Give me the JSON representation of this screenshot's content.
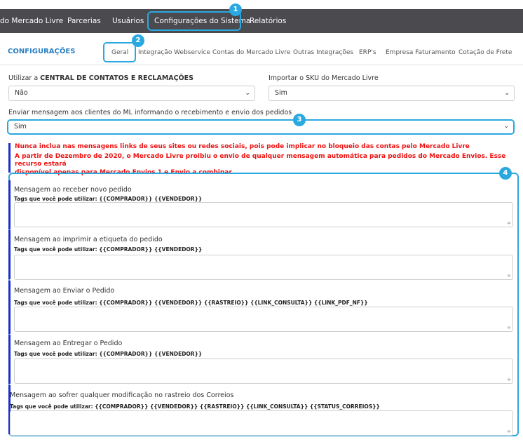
{
  "topnav": {
    "items": [
      "do Mercado Livre",
      "Parcerias",
      "Usuários",
      "Configurações do Sistema",
      "Relatórios"
    ]
  },
  "badges": [
    "1",
    "2",
    "3",
    "4"
  ],
  "config": {
    "title": "CONFIGURAÇÕES",
    "tabs": [
      "Geral",
      "Integração Webservice",
      "Contas do Mercado Livre",
      "Outras Integrações",
      "ERP's",
      "Empresa Faturamento",
      "Cotação de Frete"
    ]
  },
  "form": {
    "central_label_prefix": "Utilizar a ",
    "central_label_bold": "CENTRAL DE CONTATOS E RECLAMAÇÕES",
    "central_value": "Não",
    "sku_label": "Importar o SKU do Mercado Livre",
    "sku_value": "Sim",
    "send_label": "Enviar mensagem aos clientes do ML informando o recebimento e envio dos pedidos",
    "send_value": "Sim"
  },
  "warnings": [
    "Nunca inclua nas mensagens links de seus sites ou redes sociais, pois pode implicar no bloqueio das contas pelo Mercado Livre",
    "A partir de Dezembro de 2020, o Mercado Livre proibiu o envio de qualquer mensagem automática para pedidos do Mercado Envios. Esse recurso estará",
    "disponível apenas para Mercado Envios 1 e Envio a combinar."
  ],
  "messages": [
    {
      "title": "Mensagem ao receber novo pedido",
      "tags": "Tags que você pode utilizar: {{COMPRADOR}} {{VENDEDOR}}"
    },
    {
      "title": "Mensagem ao imprimir a etiqueta do pedido",
      "tags": "Tags que você pode utilizar: {{COMPRADOR}} {{VENDEDOR}}"
    },
    {
      "title": "Mensagem ao Enviar o Pedido",
      "tags": "Tags que você pode utilizar: {{COMPRADOR}} {{VENDEDOR}} {{RASTREIO}} {{LINK_CONSULTA}} {{LINK_PDF_NF}}"
    },
    {
      "title": "Mensagem ao Entregar o Pedido",
      "tags": "Tags que você pode utilizar: {{COMPRADOR}} {{VENDEDOR}}"
    },
    {
      "title": "Mensagem ao sofrer qualquer modificação no rastreio dos Correios",
      "tags": "Tags que você pode utilizar: {{COMPRADOR}} {{VENDEDOR}} {{RASTREIO}} {{LINK_CONSULTA}} {{STATUS_CORREIOS}}"
    }
  ],
  "colors": {
    "accent": "#2aa8e0",
    "nav": "#4a4a4f",
    "warning": "#ee1111",
    "bar": "#1a2ecc"
  }
}
